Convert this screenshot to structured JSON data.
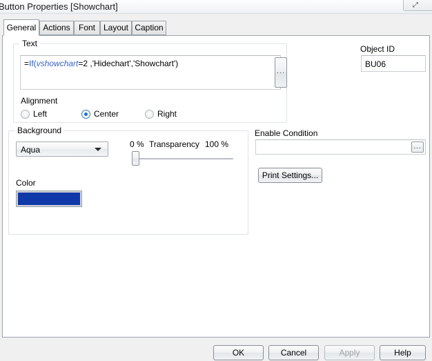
{
  "window": {
    "title": "Button Properties [Showchart]",
    "restore_glyph": "⤢"
  },
  "tabs": [
    {
      "label": "General",
      "active": true
    },
    {
      "label": "Actions",
      "active": false
    },
    {
      "label": "Font",
      "active": false
    },
    {
      "label": "Layout",
      "active": false
    },
    {
      "label": "Caption",
      "active": false
    }
  ],
  "text_group": {
    "label": "Text",
    "expression": {
      "full": "=If(vshowchart=2 ,'Hidechart','Showchart')",
      "prefix": "=",
      "function": "If(",
      "variable": "vshowchart",
      "suffix": "=2 ,'Hidechart','Showchart')"
    },
    "browse_button": "...",
    "alignment": {
      "label": "Alignment",
      "options": [
        {
          "label": "Left",
          "checked": false
        },
        {
          "label": "Center",
          "checked": true
        },
        {
          "label": "Right",
          "checked": false
        }
      ]
    }
  },
  "background_group": {
    "label": "Background",
    "style_combo": {
      "value": "Aqua",
      "icon": "chevron-down-icon"
    },
    "transparency": {
      "label": "Transparency",
      "min_label": "0 %",
      "max_label": "100 %",
      "value": 0
    },
    "color": {
      "label": "Color",
      "value": "#0f38a8"
    }
  },
  "object_id": {
    "label": "Object ID",
    "value": "BU06"
  },
  "enable_condition": {
    "label": "Enable Condition",
    "value": "",
    "browse_button": "..."
  },
  "print_settings": {
    "label": "Print Settings..."
  },
  "footer_buttons": [
    {
      "label": "OK",
      "enabled": true
    },
    {
      "label": "Cancel",
      "enabled": true
    },
    {
      "label": "Apply",
      "enabled": false
    },
    {
      "label": "Help",
      "enabled": true
    }
  ]
}
